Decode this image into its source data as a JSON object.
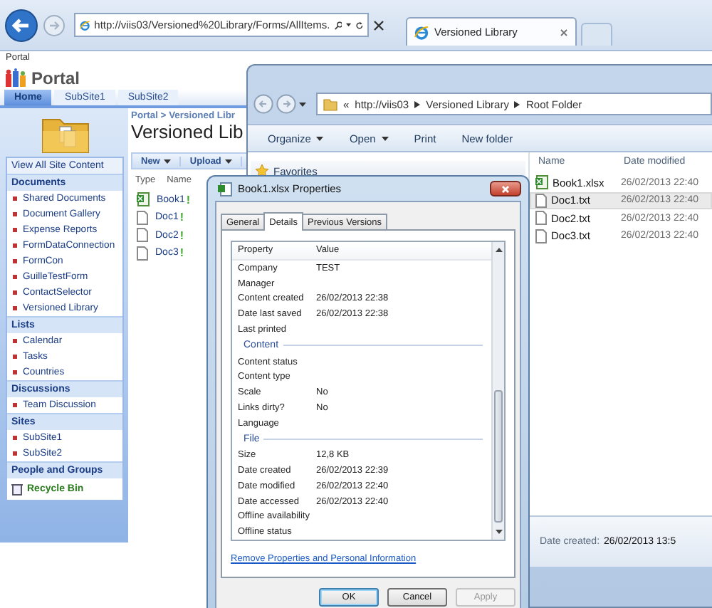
{
  "browser": {
    "address": "http://viis03/Versioned%20Library/Forms/AllItems.",
    "tabs": [
      {
        "label": "Versioned Library",
        "selected": true
      }
    ]
  },
  "portal": {
    "site_bar": "Portal",
    "site_title": "Portal",
    "tabs": [
      {
        "label": "Home",
        "selected": true
      },
      {
        "label": "SubSite1",
        "selected": false
      },
      {
        "label": "SubSite2",
        "selected": false
      }
    ],
    "breadcrumb": "Portal > Versioned Libr",
    "title": "Versioned Lib",
    "toolbar": [
      {
        "label": "New",
        "dropdown": true
      },
      {
        "label": "Upload",
        "dropdown": true
      }
    ],
    "quick_launch": {
      "view_all": "View All Site Content",
      "sections": [
        {
          "heading": "Documents",
          "items": [
            "Shared Documents",
            "Document Gallery",
            "Expense Reports",
            "FormDataConnection",
            "FormCon",
            "GuilleTestForm",
            "ContactSelector",
            "Versioned Library"
          ]
        },
        {
          "heading": "Lists",
          "items": [
            "Calendar",
            "Tasks",
            "Countries"
          ]
        },
        {
          "heading": "Discussions",
          "items": [
            "Team Discussion"
          ]
        },
        {
          "heading": "Sites",
          "items": [
            "SubSite1",
            "SubSite2"
          ]
        },
        {
          "heading": "People and Groups"
        }
      ],
      "recycle_bin": "Recycle Bin"
    },
    "list": {
      "columns": [
        "Type",
        "Name"
      ],
      "rows": [
        {
          "name": "Book1",
          "kind": "excel",
          "flag": "!"
        },
        {
          "name": "Doc1",
          "kind": "text",
          "flag": "!"
        },
        {
          "name": "Doc2",
          "kind": "text",
          "flag": "!"
        },
        {
          "name": "Doc3",
          "kind": "text",
          "flag": "!"
        }
      ]
    }
  },
  "explorer": {
    "path_prefix": "«",
    "path": [
      "http://viis03",
      "Versioned Library",
      "Root Folder"
    ],
    "toolbar": [
      {
        "label": "Organize",
        "dropdown": true
      },
      {
        "label": "Open",
        "dropdown": true
      },
      {
        "label": "Print",
        "dropdown": false
      },
      {
        "label": "New folder",
        "dropdown": false
      }
    ],
    "favorites": "Favorites",
    "columns": [
      "Name",
      "Date modified"
    ],
    "files": [
      {
        "name": "Book1.xlsx",
        "kind": "excel",
        "modified": "26/02/2013 22:40",
        "selected": false
      },
      {
        "name": "Doc1.txt",
        "kind": "text",
        "modified": "26/02/2013 22:40",
        "selected": true
      },
      {
        "name": "Doc2.txt",
        "kind": "text",
        "modified": "26/02/2013 22:40",
        "selected": false
      },
      {
        "name": "Doc3.txt",
        "kind": "text",
        "modified": "26/02/2013 22:40",
        "selected": false
      }
    ],
    "details": {
      "label": "Date created:",
      "value": "26/02/2013 13:5"
    }
  },
  "dialog": {
    "title": "Book1.xlsx Properties",
    "tabs": [
      {
        "label": "General",
        "selected": false
      },
      {
        "label": "Details",
        "selected": true
      },
      {
        "label": "Previous Versions",
        "selected": false
      }
    ],
    "columns": [
      "Property",
      "Value"
    ],
    "rows": [
      {
        "kind": "row",
        "property": "Company",
        "value": "TEST"
      },
      {
        "kind": "row",
        "property": "Manager"
      },
      {
        "kind": "row",
        "property": "Content created",
        "value": "26/02/2013 22:38"
      },
      {
        "kind": "row",
        "property": "Date last saved",
        "value": "26/02/2013 22:38"
      },
      {
        "kind": "row",
        "property": "Last printed"
      },
      {
        "kind": "section",
        "property": "Content"
      },
      {
        "kind": "row",
        "property": "Content status"
      },
      {
        "kind": "row",
        "property": "Content type"
      },
      {
        "kind": "row",
        "property": "Scale",
        "value": "No"
      },
      {
        "kind": "row",
        "property": "Links dirty?",
        "value": "No"
      },
      {
        "kind": "row",
        "property": "Language"
      },
      {
        "kind": "section",
        "property": "File"
      },
      {
        "kind": "row",
        "property": "Size",
        "value": "12,8 KB"
      },
      {
        "kind": "row",
        "property": "Date created",
        "value": "26/02/2013 22:39"
      },
      {
        "kind": "row",
        "property": "Date modified",
        "value": "26/02/2013 22:40"
      },
      {
        "kind": "row",
        "property": "Date accessed",
        "value": "26/02/2013 22:40"
      },
      {
        "kind": "row",
        "property": "Offline availability"
      },
      {
        "kind": "row",
        "property": "Offline status"
      }
    ],
    "link": "Remove Properties and Personal Information",
    "buttons": [
      {
        "label": "OK",
        "default": true,
        "disabled": false
      },
      {
        "label": "Cancel",
        "default": false,
        "disabled": false
      },
      {
        "label": "Apply",
        "default": false,
        "disabled": true
      }
    ]
  }
}
